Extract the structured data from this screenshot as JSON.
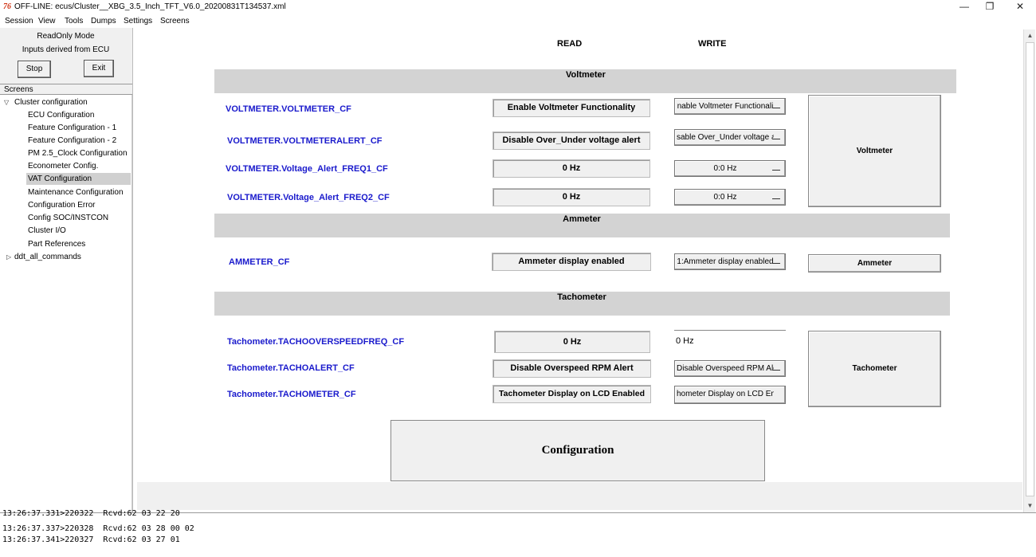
{
  "window": {
    "title": "OFF-LINE: ecus/Cluster__XBG_3.5_Inch_TFT_V6.0_20200831T134537.xml",
    "app_icon": "76"
  },
  "menu": [
    "Session",
    "View",
    "Tools",
    "Dumps",
    "Settings",
    "Screens"
  ],
  "sidebar": {
    "mode": "ReadOnly Mode",
    "inputs": "Inputs derived from ECU",
    "stop_label": "Stop",
    "exit_label": "Exit",
    "screens_label": "Screens",
    "tree": {
      "root": "Cluster configuration",
      "children": [
        "ECU Configuration",
        "Feature Configuration - 1",
        "Feature Configuration - 2",
        "PM 2.5_Clock Configuration",
        "Econometer Config.",
        "VAT Configuration",
        "Maintenance Configuration",
        "Configuration Error",
        "Config SOC/INSTCON",
        "Cluster I/O",
        "Part References"
      ],
      "selected": "VAT Configuration",
      "other": "ddt_all_commands"
    }
  },
  "main": {
    "read_header": "READ",
    "write_header": "WRITE",
    "voltmeter": {
      "title": "Voltmeter",
      "button": "Voltmeter",
      "rows": [
        {
          "name": "VOLTMETER.VOLTMETER_CF",
          "read": "Enable Voltmeter Functionality",
          "write": "nable Voltmeter Functionali"
        },
        {
          "name": "VOLTMETER.VOLTMETERALERT_CF",
          "read": "Disable Over_Under voltage alert",
          "write": "sable Over_Under voltage al"
        },
        {
          "name": "VOLTMETER.Voltage_Alert_FREQ1_CF",
          "read": "0 Hz",
          "write": "0:0 Hz"
        },
        {
          "name": "VOLTMETER.Voltage_Alert_FREQ2_CF",
          "read": "0 Hz",
          "write": "0:0 Hz"
        }
      ]
    },
    "ammeter": {
      "title": "Ammeter",
      "button": "Ammeter",
      "rows": [
        {
          "name": "AMMETER_CF",
          "read": "Ammeter display enabled",
          "write": "1:Ammeter display enabled"
        }
      ]
    },
    "tachometer": {
      "title": "Tachometer",
      "button": "Tachometer",
      "rows": [
        {
          "name": "Tachometer.TACHOOVERSPEEDFREQ_CF",
          "read": "0 Hz",
          "write": "0 Hz"
        },
        {
          "name": "Tachometer.TACHOALERT_CF",
          "read": "Disable Overspeed RPM Alert",
          "write": "Disable Overspeed RPM Aler"
        },
        {
          "name": "Tachometer.TACHOMETER_CF",
          "read": "Tachometer Display on LCD Enabled",
          "write": "hometer Display on LCD Enab"
        }
      ]
    },
    "config_button": "Configuration"
  },
  "log": [
    "13:26:37.331>220322  Rcvd:62 03 22 20",
    "13:26:37.337>220328  Rcvd:62 03 28 00 02",
    "13:26:37.341>220327  Rcvd:62 03 27 01"
  ]
}
